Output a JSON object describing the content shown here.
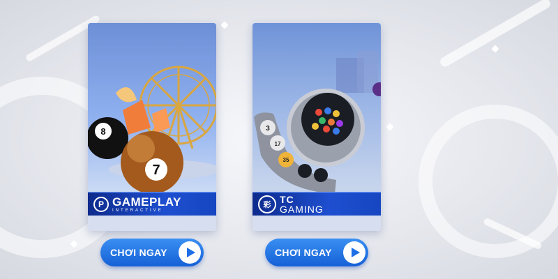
{
  "games": [
    {
      "provider_name": "GAMEPLAY",
      "provider_sub": "INTERACTIVE",
      "logo_letter": "P",
      "button_label": "CHƠI NGAY",
      "balls": [
        "8",
        "7"
      ]
    },
    {
      "provider_name": "TC",
      "provider_sub": "GAMING",
      "logo_letter": "彩",
      "button_label": "CHƠI NGAY",
      "balls": [
        "3",
        "17",
        "35"
      ]
    }
  ],
  "colors": {
    "button": "#1e6fe6",
    "brand_bar": "#1646c0",
    "background": "#e6e8ee"
  },
  "icons": [
    "play-icon",
    "gameplay-logo-icon",
    "tc-gaming-logo-icon"
  ]
}
